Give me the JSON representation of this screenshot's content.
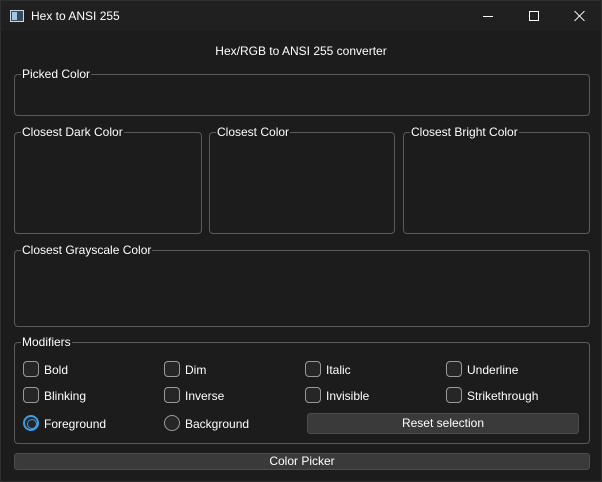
{
  "window": {
    "title": "Hex to ANSI 255",
    "icon": "app-icon"
  },
  "heading": "Hex/RGB to ANSI 255 converter",
  "groups": {
    "picked": "Picked Color",
    "dark": "Closest Dark Color",
    "closest": "Closest Color",
    "bright": "Closest Bright Color",
    "grayscale": "Closest Grayscale Color",
    "modifiers": "Modifiers"
  },
  "modifiers": {
    "bold": "Bold",
    "dim": "Dim",
    "italic": "Italic",
    "underline": "Underline",
    "blinking": "Blinking",
    "inverse": "Inverse",
    "invisible": "Invisible",
    "strikethrough": "Strikethrough"
  },
  "target": {
    "foreground": "Foreground",
    "background": "Background",
    "selected": "Foreground"
  },
  "buttons": {
    "reset": "Reset selection",
    "picker": "Color Picker"
  },
  "colors": {
    "background": "#1c1c1c",
    "accent": "#3c9ce6",
    "border": "#5a5a5a",
    "button": "#3a3a3a"
  }
}
